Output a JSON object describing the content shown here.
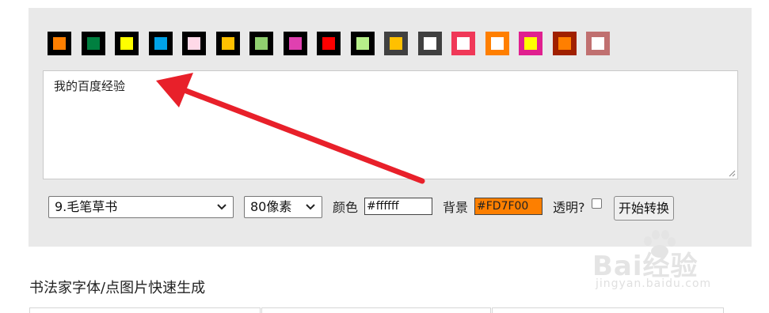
{
  "swatches": [
    {
      "border": "#000000",
      "fill": "#ff7f00"
    },
    {
      "border": "#000000",
      "fill": "#008040"
    },
    {
      "border": "#000000",
      "fill": "#ffff00"
    },
    {
      "border": "#000000",
      "fill": "#00a2e8"
    },
    {
      "border": "#000000",
      "fill": "#ffd9e8"
    },
    {
      "border": "#000000",
      "fill": "#ffc000"
    },
    {
      "border": "#000000",
      "fill": "#8fcf6f"
    },
    {
      "border": "#000000",
      "fill": "#e040b0"
    },
    {
      "border": "#000000",
      "fill": "#ff0000"
    },
    {
      "border": "#000000",
      "fill": "#b7f08a"
    },
    {
      "border": "#404040",
      "fill": "#ffc000"
    },
    {
      "border": "#404040",
      "fill": "#ffffff"
    },
    {
      "border": "#f03858",
      "fill": "#ffffff"
    },
    {
      "border": "#ff7f00",
      "fill": "#ffffff"
    },
    {
      "border": "#e0208f",
      "fill": "#ffff00"
    },
    {
      "border": "#a02000",
      "fill": "#ff7f00"
    },
    {
      "border": "#c07070",
      "fill": "#ffffff"
    }
  ],
  "editor": {
    "text": "我的百度经验"
  },
  "controls": {
    "font_select": "9.毛笔草书",
    "size_select": "80像素",
    "color_label": "颜色",
    "color_value": "#ffffff",
    "bg_label": "背景",
    "bg_value": "#FD7F00",
    "transparent_label": "透明?",
    "transparent_checked": false,
    "start_button": "开始转换"
  },
  "section": {
    "title": "书法家字体/点图片快速生成"
  },
  "watermark": {
    "main": "Bai经验",
    "sub": "jingyan.baidu.com"
  },
  "colors": {
    "panel_bg": "#e9e9e9",
    "arrow": "#e8202a",
    "bg_field": "#fd7f00"
  }
}
